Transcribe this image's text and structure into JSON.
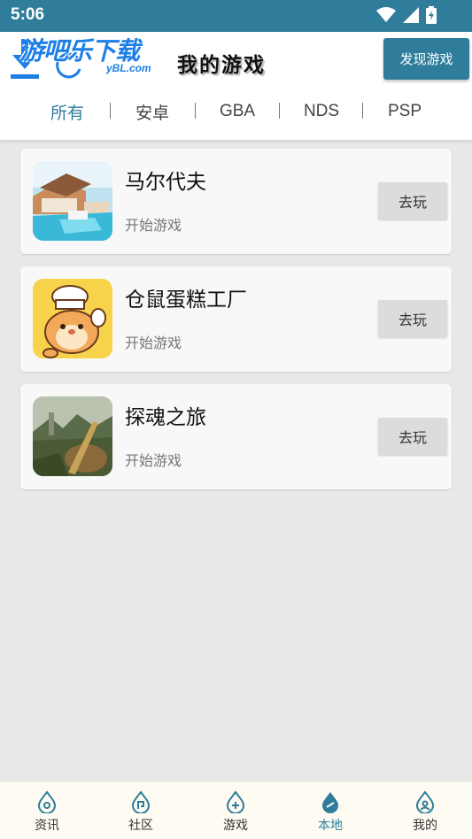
{
  "status": {
    "time": "5:06"
  },
  "watermark": {
    "text": "游吧乐下载",
    "sub": "yBL.com"
  },
  "header": {
    "title": "我的游戏",
    "discover_label": "发现游戏"
  },
  "tabs": [
    "所有",
    "安卓",
    "GBA",
    "NDS",
    "PSP"
  ],
  "games": [
    {
      "name": "马尔代夫",
      "subtitle": "开始游戏",
      "play_label": "去玩"
    },
    {
      "name": "仓鼠蛋糕工厂",
      "subtitle": "开始游戏",
      "play_label": "去玩"
    },
    {
      "name": "探魂之旅",
      "subtitle": "开始游戏",
      "play_label": "去玩"
    }
  ],
  "nav": [
    "资讯",
    "社区",
    "游戏",
    "本地",
    "我的"
  ],
  "colors": {
    "accent": "#2f7d9a",
    "watermark": "#1d7fe6"
  }
}
